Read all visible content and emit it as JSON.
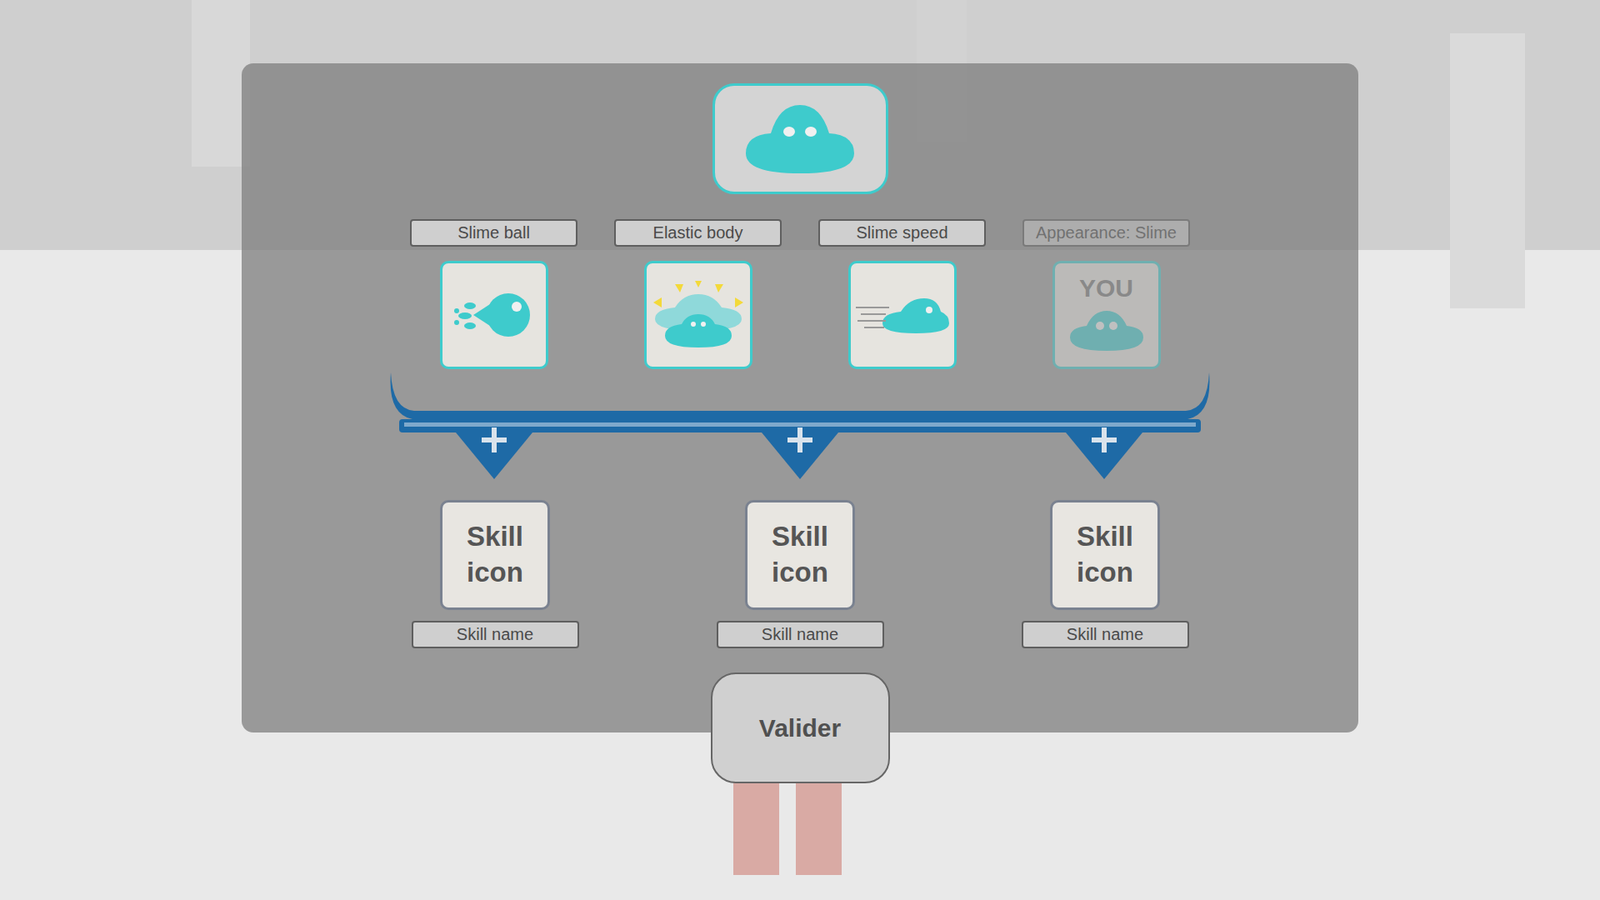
{
  "skills": [
    {
      "label": "Slime ball",
      "kind": "ball",
      "icon_text": "",
      "disabled": false
    },
    {
      "label": "Elastic body",
      "kind": "elastic",
      "icon_text": "",
      "disabled": false
    },
    {
      "label": "Slime speed",
      "kind": "speed",
      "icon_text": "",
      "disabled": false
    },
    {
      "label": "Appearance: Slime",
      "kind": "appearance",
      "icon_text": "YOU",
      "disabled": true
    }
  ],
  "slots": [
    {
      "icon": "Skill icon",
      "name": "Skill name"
    },
    {
      "icon": "Skill icon",
      "name": "Skill name"
    },
    {
      "icon": "Skill icon",
      "name": "Skill name"
    }
  ],
  "button": "Valider"
}
